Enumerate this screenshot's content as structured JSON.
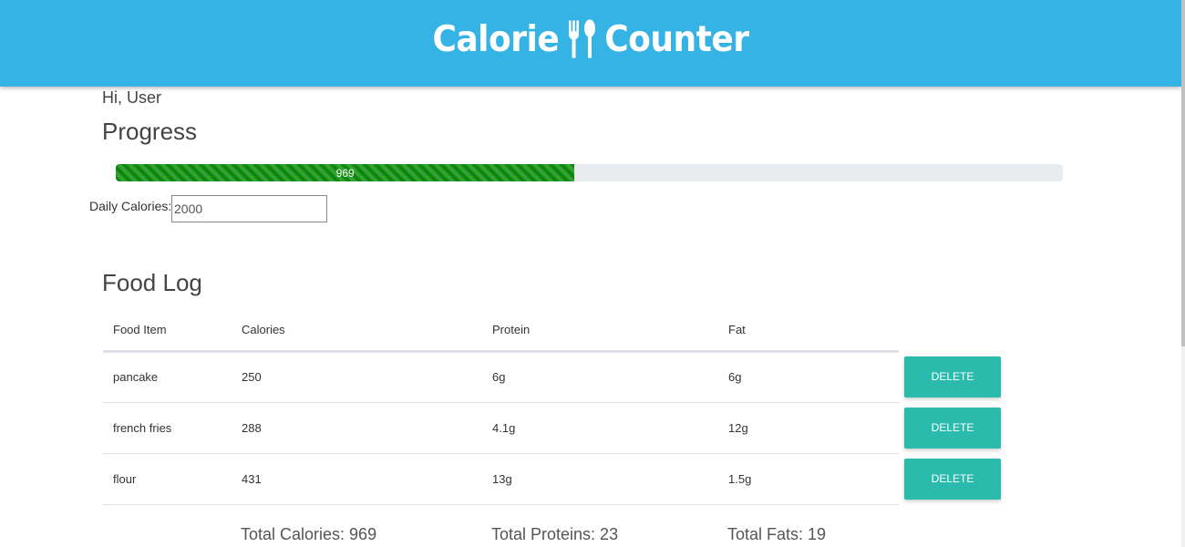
{
  "app": {
    "title_left": "Calorie",
    "title_right": "Counter",
    "logo_icon": "fork-spoon-icon",
    "header_color": "#34b3e4"
  },
  "greeting": "Hi, User",
  "progress": {
    "title": "Progress",
    "current": 969,
    "goal": 2000,
    "fraction": 0.4845,
    "label": "969",
    "bar_color": "#0a8a0a"
  },
  "daily_calories": {
    "label": "Daily Calories:",
    "value": "2000"
  },
  "food_log": {
    "title": "Food Log",
    "columns": [
      "Food Item",
      "Calories",
      "Protein",
      "Fat"
    ],
    "rows": [
      {
        "item": "pancake",
        "calories": "250",
        "protein": "6g",
        "fat": "6g",
        "action": "DELETE"
      },
      {
        "item": "french fries",
        "calories": "288",
        "protein": "4.1g",
        "fat": "12g",
        "action": "DELETE"
      },
      {
        "item": "flour",
        "calories": "431",
        "protein": "13g",
        "fat": "1.5g",
        "action": "DELETE"
      }
    ],
    "delete_color": "#2bbbad"
  },
  "totals": {
    "calories": "Total Calories: 969",
    "proteins": "Total Proteins: 23",
    "fats": "Total Fats: 19"
  }
}
